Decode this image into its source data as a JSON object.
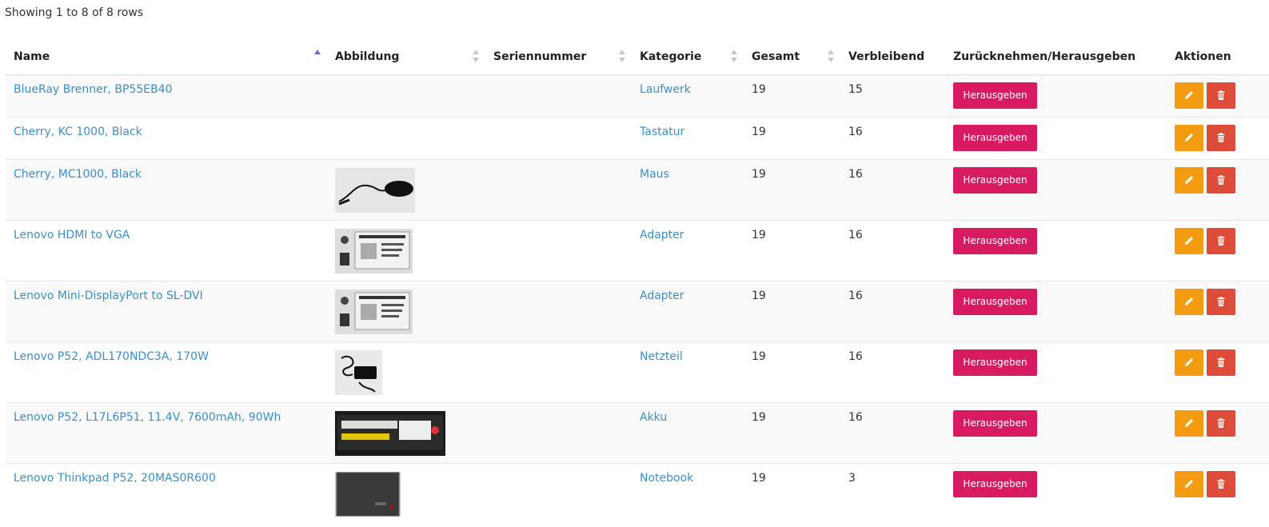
{
  "pagination_info": "Showing 1 to 8 of 8 rows",
  "columns": [
    {
      "label": "Name",
      "sort": "asc"
    },
    {
      "label": "Abbildung",
      "sort": "both"
    },
    {
      "label": "Seriennummer",
      "sort": "both"
    },
    {
      "label": "Kategorie",
      "sort": "both"
    },
    {
      "label": "Gesamt",
      "sort": "both"
    },
    {
      "label": "Verbleibend",
      "sort": "none"
    },
    {
      "label": "Zurücknehmen/Herausgeben",
      "sort": "none"
    },
    {
      "label": "Aktionen",
      "sort": "none"
    }
  ],
  "issue_button_label": "Herausgeben",
  "icons": {
    "edit": "pencil-icon",
    "delete": "trash-icon"
  },
  "colors": {
    "link": "#3b8fc8",
    "issue_button": "#d81b60",
    "edit_button": "#f39c12",
    "delete_button": "#dd4b39",
    "sort_active": "#6c6cd8"
  },
  "rows": [
    {
      "name": "BlueRay Brenner, BP55EB40",
      "image": "",
      "serial": "",
      "category": "Laufwerk",
      "total": "19",
      "remaining": "15"
    },
    {
      "name": "Cherry, KC 1000, Black",
      "image": "",
      "serial": "",
      "category": "Tastatur",
      "total": "19",
      "remaining": "16"
    },
    {
      "name": "Cherry, MC1000, Black",
      "image": "mouse",
      "serial": "",
      "category": "Maus",
      "total": "19",
      "remaining": "16"
    },
    {
      "name": "Lenovo HDMI to VGA",
      "image": "adapter-package",
      "serial": "",
      "category": "Adapter",
      "total": "19",
      "remaining": "16"
    },
    {
      "name": "Lenovo Mini-DisplayPort to SL-DVI",
      "image": "adapter-package",
      "serial": "",
      "category": "Adapter",
      "total": "19",
      "remaining": "16"
    },
    {
      "name": "Lenovo P52, ADL170NDC3A, 170W",
      "image": "power-supply",
      "serial": "",
      "category": "Netzteil",
      "total": "19",
      "remaining": "16"
    },
    {
      "name": "Lenovo P52, L17L6P51, 11.4V, 7600mAh, 90Wh",
      "image": "battery",
      "serial": "",
      "category": "Akku",
      "total": "19",
      "remaining": "16"
    },
    {
      "name": "Lenovo Thinkpad P52, 20MAS0R600",
      "image": "notebook",
      "serial": "",
      "category": "Notebook",
      "total": "19",
      "remaining": "3"
    }
  ]
}
